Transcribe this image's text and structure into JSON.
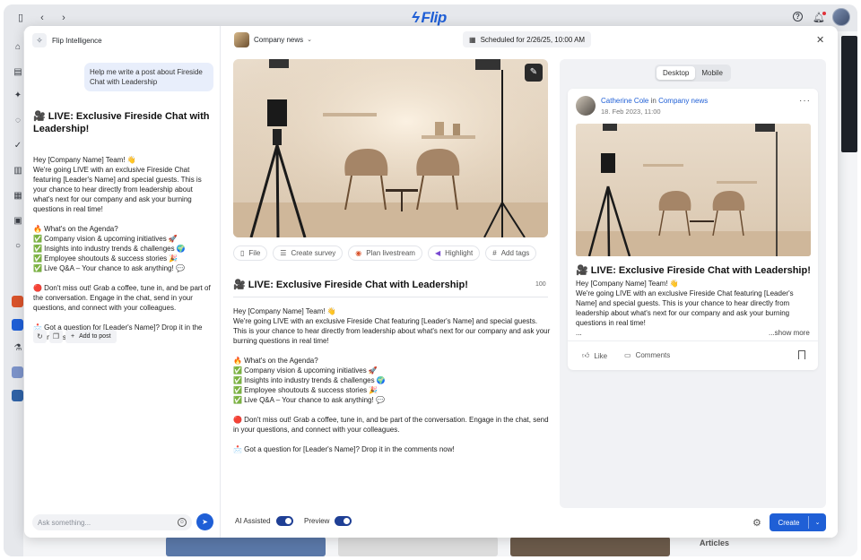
{
  "topbar": {
    "brand": "Flip",
    "icons": [
      "sidebar-toggle-icon",
      "back-icon",
      "forward-icon",
      "help-icon",
      "bell-icon",
      "avatar"
    ]
  },
  "background": {
    "articles_label": "Articles"
  },
  "ai_panel": {
    "title": "Flip Intelligence",
    "user_prompt": "Help me write a post about Fireside Chat with Leadership",
    "heading": "🎥 LIVE: Exclusive Fireside Chat with Leadership!",
    "response": "Hey [Company Name] Team! 👋\nWe're going LIVE with an exclusive Fireside Chat featuring [Leader's Name] and special guests. This is your chance to hear directly from leadership about what's next for our company and ask your burning questions in real time!\n\n🔥 What's on the Agenda?\n✅ Company vision & upcoming initiatives 🚀\n✅ Insights into industry trends & challenges 🌍\n✅ Employee shoutouts & success stories 🎉\n✅ Live Q&A – Your chance to ask anything! 💬\n\n🔴 Don't miss out! Grab a coffee, tune in, and be part of the conversation. Engage in the chat, send in your questions, and connect with your colleagues.\n\n📩 Got a question for [Leader's Name]? Drop it in the comments now!",
    "add_to_post": "Add to post",
    "ask_placeholder": "Ask something..."
  },
  "editor": {
    "channel": "Company news",
    "schedule": "Scheduled for 2/26/25, 10:00 AM",
    "chips": [
      {
        "label": "File",
        "icon": "file-icon"
      },
      {
        "label": "Create survey",
        "icon": "survey-icon"
      },
      {
        "label": "Plan livestream",
        "icon": "livestream-icon"
      },
      {
        "label": "Highlight",
        "icon": "megaphone-icon"
      },
      {
        "label": "Add tags",
        "icon": "hash-icon"
      }
    ],
    "title": "🎥 LIVE: Exclusive Fireside Chat with Leadership!",
    "char_count": "100",
    "body": "Hey [Company Name] Team! 👋\nWe're going LIVE with an exclusive Fireside Chat featuring [Leader's Name] and special guests. This is your chance to hear directly from leadership about what's next for our company and ask your burning questions in real time!\n\n🔥 What's on the Agenda?\n✅ Company vision & upcoming initiatives 🚀\n✅ Insights into industry trends & challenges 🌍\n✅ Employee shoutouts & success stories 🎉\n✅ Live Q&A – Your chance to ask anything! 💬\n\n🔴 Don't miss out! Grab a coffee, tune in, and be part of the conversation. Engage in the chat, send in your questions, and connect with your colleagues.\n\n📩 Got a question for [Leader's Name]? Drop it in the comments now!"
  },
  "preview": {
    "tabs": [
      "Desktop",
      "Mobile"
    ],
    "active_tab": "Desktop",
    "author": "Catherine Cole",
    "in_word": "in",
    "channel": "Company news",
    "date": "18. Feb 2023, 11:00",
    "title": "🎥 LIVE: Exclusive Fireside Chat with Leadership!",
    "excerpt": "Hey [Company Name] Team! 👋\nWe're going LIVE with an exclusive Fireside Chat featuring [Leader's Name] and special guests. This is your chance to hear directly from leadership about what's next for our company and ask your burning questions in real time!",
    "ellipsis": "...",
    "show_more": "...show more",
    "like": "Like",
    "comments": "Comments"
  },
  "footer": {
    "ai_assisted": "AI Assisted",
    "ai_assisted_on": true,
    "preview": "Preview",
    "preview_on": true,
    "create": "Create"
  },
  "colors": {
    "accent": "#1f5fd6",
    "toggle": "#1f3f95"
  }
}
